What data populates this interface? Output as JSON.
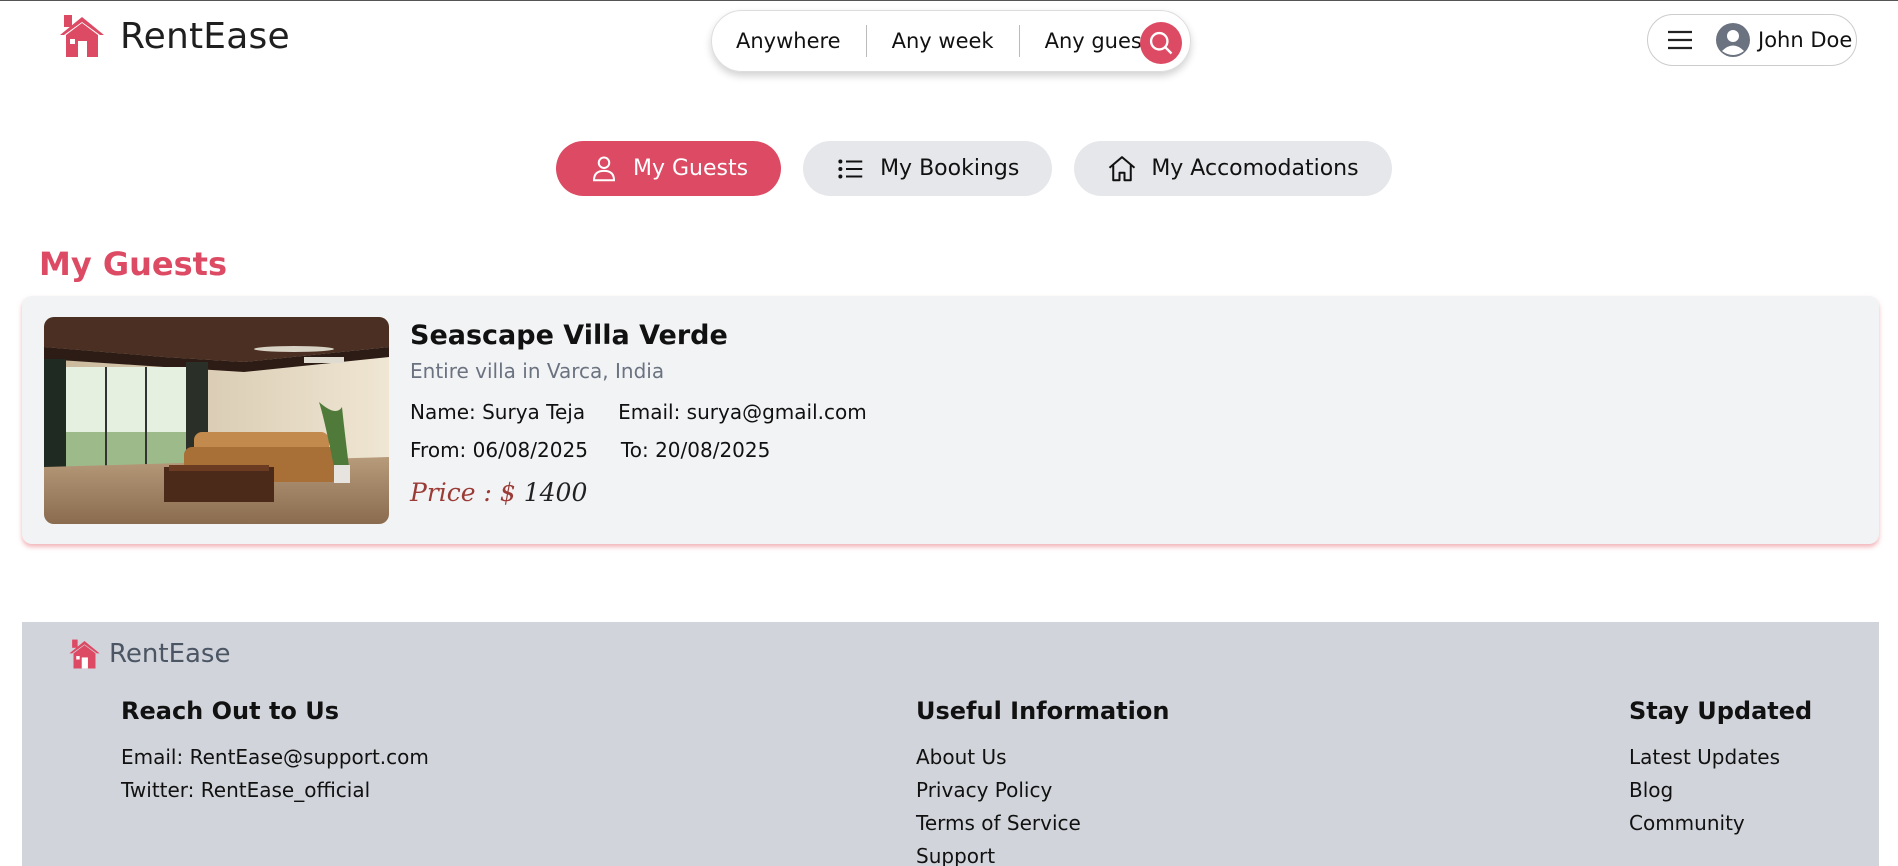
{
  "brand": {
    "name": "RentEase",
    "accent": "#dd4a63"
  },
  "search": {
    "where": "Anywhere",
    "when": "Any week",
    "who": "Any guests"
  },
  "user": {
    "name": "John Doe"
  },
  "tabs": [
    {
      "label": "My Guests",
      "icon": "user-icon",
      "active": true
    },
    {
      "label": "My Bookings",
      "icon": "list-icon",
      "active": false
    },
    {
      "label": "My Accomodations",
      "icon": "home-icon",
      "active": false
    }
  ],
  "section_title": "My Guests",
  "booking": {
    "title": "Seascape Villa Verde",
    "subtitle": "Entire villa in Varca, India",
    "name": "Name: Surya Teja",
    "email": "Email: surya@gmail.com",
    "from": "From: 06/08/2025",
    "to": "To: 20/08/2025",
    "price_label": "Price : $",
    "price_value": "1400"
  },
  "footer": {
    "brand": "RentEase",
    "contact": {
      "heading": "Reach Out to Us",
      "lines": [
        "Email: RentEase@support.com",
        "Twitter: RentEase_official"
      ]
    },
    "info": {
      "heading": "Useful Information",
      "links": [
        "About Us",
        "Privacy Policy",
        "Terms of Service",
        "Support"
      ]
    },
    "updates": {
      "heading": "Stay Updated",
      "links": [
        "Latest Updates",
        "Blog",
        "Community"
      ]
    }
  }
}
